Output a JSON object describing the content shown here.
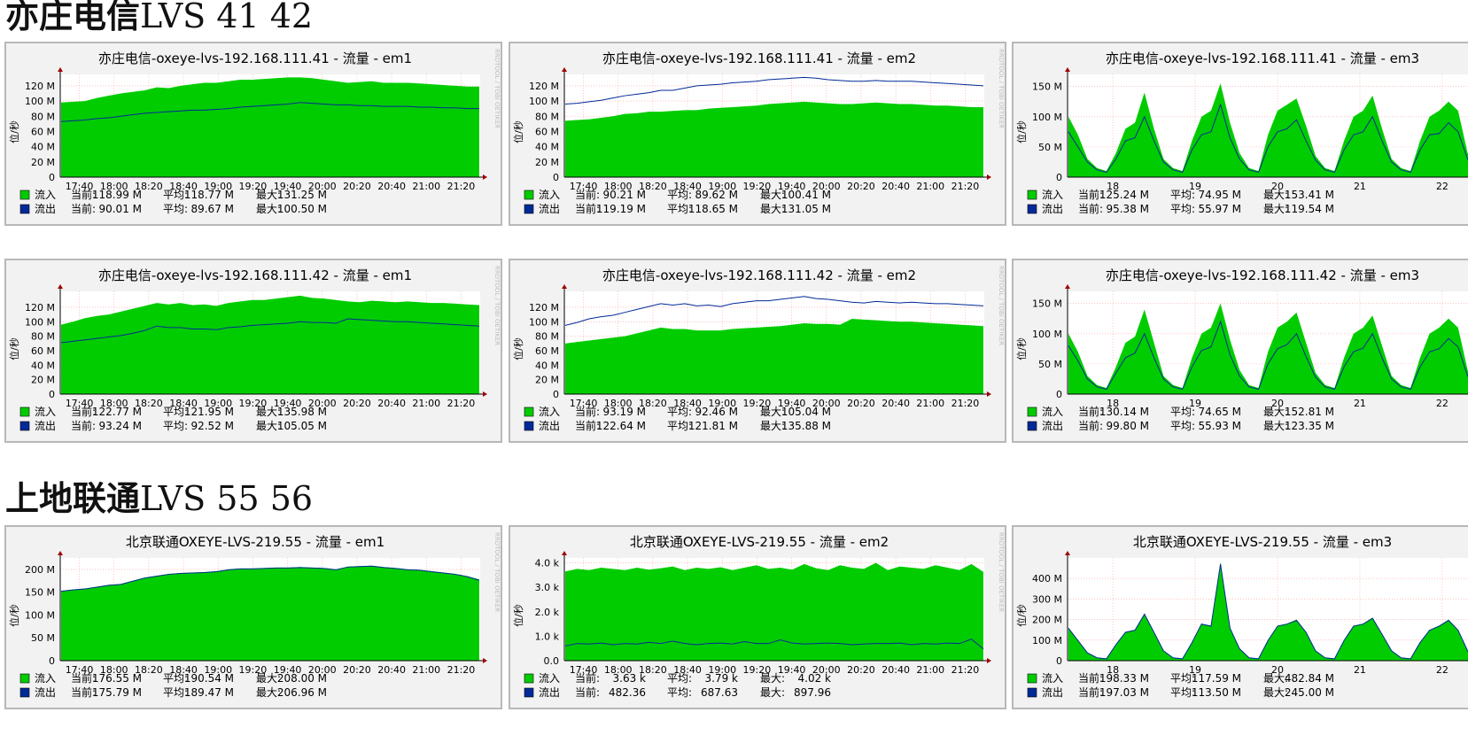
{
  "sections": [
    {
      "title_zh": "亦庄电信",
      "title_rest": "LVS 41 42"
    },
    {
      "title_zh": "上地联通",
      "title_rest": "LVS 55 56"
    }
  ],
  "watermark": "RRDTOOL / TOBI OETIKER",
  "ylabel": "位/秒",
  "legend": {
    "in": "流入",
    "out": "流出",
    "cur": "当前:",
    "avg": "平均:",
    "max": "最大:"
  },
  "colors": {
    "in": "#00cc00",
    "out": "#002a97",
    "grid": "#ff9d9d",
    "bg": "#f2f2f2"
  },
  "chart_data": [
    {
      "type": "area",
      "title": "亦庄电信-oxeye-lvs-192.168.111.41 - 流量 - em1",
      "yticks": [
        "0",
        "20 M",
        "40 M",
        "60 M",
        "80 M",
        "100 M",
        "120 M"
      ],
      "ylim": [
        0,
        135
      ],
      "xticks": [
        "17:40",
        "18:00",
        "18:20",
        "18:40",
        "19:00",
        "19:20",
        "19:40",
        "20:00",
        "20:20",
        "20:40",
        "21:00",
        "21:20"
      ],
      "series": [
        {
          "name": "流入",
          "values": [
            98,
            99,
            100,
            104,
            107,
            110,
            112,
            114,
            118,
            117,
            120,
            122,
            124,
            124,
            126,
            128,
            128,
            129,
            130,
            131,
            131,
            130,
            128,
            126,
            124,
            125,
            126,
            124,
            124,
            124,
            123,
            122,
            121,
            120,
            119,
            119
          ]
        },
        {
          "name": "流出",
          "values": [
            73,
            74,
            75,
            77,
            78,
            80,
            82,
            84,
            85,
            86,
            87,
            88,
            88,
            89,
            90,
            92,
            93,
            94,
            95,
            96,
            98,
            97,
            96,
            95,
            95,
            94,
            94,
            93,
            93,
            93,
            92,
            92,
            91,
            91,
            90,
            90
          ]
        }
      ],
      "stats": {
        "in": [
          "118.99 M",
          "118.77 M",
          "131.25 M"
        ],
        "out": [
          "90.01 M",
          "89.67 M",
          "100.50 M"
        ]
      }
    },
    {
      "type": "area",
      "title": "亦庄电信-oxeye-lvs-192.168.111.41 - 流量 - em2",
      "yticks": [
        "0",
        "20 M",
        "40 M",
        "60 M",
        "80 M",
        "100 M",
        "120 M"
      ],
      "ylim": [
        0,
        135
      ],
      "xticks": [
        "17:40",
        "18:00",
        "18:20",
        "18:40",
        "19:00",
        "19:20",
        "19:40",
        "20:00",
        "20:20",
        "20:40",
        "21:00",
        "21:20"
      ],
      "series": [
        {
          "name": "流入",
          "values": [
            74,
            75,
            76,
            78,
            80,
            83,
            84,
            86,
            86,
            87,
            88,
            88,
            90,
            91,
            92,
            93,
            94,
            96,
            97,
            98,
            99,
            98,
            97,
            96,
            96,
            97,
            98,
            97,
            96,
            96,
            95,
            94,
            94,
            93,
            92,
            92
          ]
        },
        {
          "name": "流出",
          "values": [
            96,
            97,
            99,
            101,
            104,
            107,
            109,
            111,
            114,
            114,
            117,
            120,
            121,
            122,
            124,
            125,
            126,
            128,
            129,
            130,
            131,
            130,
            128,
            127,
            126,
            126,
            127,
            126,
            126,
            126,
            125,
            124,
            123,
            122,
            121,
            120
          ]
        }
      ],
      "stats": {
        "in": [
          "90.21 M",
          "89.62 M",
          "100.41 M"
        ],
        "out": [
          "119.19 M",
          "118.65 M",
          "131.05 M"
        ]
      }
    },
    {
      "type": "area",
      "title": "亦庄电信-oxeye-lvs-192.168.111.41 - 流量 - em3",
      "yticks": [
        "0",
        "50 M",
        "100 M",
        "150 M"
      ],
      "ylim": [
        0,
        170
      ],
      "xticks": [
        "18",
        "19",
        "20",
        "21",
        "22"
      ],
      "series": [
        {
          "name": "流入",
          "values": [
            100,
            70,
            30,
            15,
            10,
            40,
            80,
            90,
            140,
            80,
            30,
            15,
            10,
            60,
            100,
            110,
            155,
            90,
            40,
            15,
            10,
            70,
            110,
            120,
            130,
            85,
            35,
            15,
            10,
            60,
            100,
            110,
            135,
            80,
            30,
            15,
            10,
            60,
            100,
            110,
            125,
            110,
            40,
            15,
            10
          ]
        },
        {
          "name": "流出",
          "values": [
            75,
            50,
            25,
            12,
            8,
            30,
            60,
            65,
            100,
            60,
            25,
            12,
            8,
            45,
            70,
            75,
            120,
            65,
            30,
            12,
            8,
            50,
            75,
            80,
            95,
            60,
            28,
            12,
            8,
            45,
            70,
            75,
            100,
            60,
            25,
            12,
            8,
            45,
            70,
            72,
            90,
            75,
            30,
            12,
            8
          ]
        }
      ],
      "stats": {
        "in": [
          "125.24 M",
          "74.95 M",
          "153.41 M"
        ],
        "out": [
          "95.38 M",
          "55.97 M",
          "119.54 M"
        ]
      }
    },
    {
      "type": "area",
      "title": "亦庄电信-oxeye-lvs-192.168.111.42 - 流量 - em1",
      "yticks": [
        "0",
        "20 M",
        "40 M",
        "60 M",
        "80 M",
        "100 M",
        "120 M"
      ],
      "ylim": [
        0,
        142
      ],
      "xticks": [
        "17:40",
        "18:00",
        "18:20",
        "18:40",
        "19:00",
        "19:20",
        "19:40",
        "20:00",
        "20:20",
        "20:40",
        "21:00",
        "21:20"
      ],
      "series": [
        {
          "name": "流入",
          "values": [
            96,
            100,
            105,
            108,
            110,
            114,
            118,
            122,
            126,
            124,
            126,
            123,
            124,
            122,
            126,
            128,
            130,
            130,
            132,
            134,
            136,
            133,
            132,
            130,
            128,
            127,
            129,
            128,
            127,
            128,
            127,
            126,
            126,
            125,
            124,
            123
          ]
        },
        {
          "name": "流出",
          "values": [
            71,
            73,
            75,
            77,
            79,
            81,
            84,
            88,
            94,
            92,
            92,
            90,
            90,
            89,
            92,
            93,
            95,
            96,
            97,
            98,
            100,
            99,
            99,
            98,
            104,
            103,
            102,
            101,
            100,
            100,
            99,
            98,
            97,
            96,
            95,
            94
          ]
        }
      ],
      "stats": {
        "in": [
          "122.77 M",
          "121.95 M",
          "135.98 M"
        ],
        "out": [
          "93.24 M",
          "92.52 M",
          "105.05 M"
        ]
      }
    },
    {
      "type": "area",
      "title": "亦庄电信-oxeye-lvs-192.168.111.42 - 流量 - em2",
      "yticks": [
        "0",
        "20 M",
        "40 M",
        "60 M",
        "80 M",
        "100 M",
        "120 M"
      ],
      "ylim": [
        0,
        142
      ],
      "xticks": [
        "17:40",
        "18:00",
        "18:20",
        "18:40",
        "19:00",
        "19:20",
        "19:40",
        "20:00",
        "20:20",
        "20:40",
        "21:00",
        "21:20"
      ],
      "series": [
        {
          "name": "流入",
          "values": [
            70,
            72,
            74,
            76,
            78,
            80,
            84,
            88,
            92,
            90,
            90,
            88,
            88,
            88,
            90,
            91,
            92,
            93,
            94,
            96,
            98,
            97,
            97,
            96,
            104,
            103,
            102,
            101,
            100,
            100,
            99,
            98,
            97,
            96,
            95,
            94
          ]
        },
        {
          "name": "流出",
          "values": [
            95,
            99,
            104,
            107,
            109,
            113,
            117,
            121,
            125,
            123,
            125,
            122,
            123,
            121,
            125,
            127,
            129,
            129,
            131,
            133,
            135,
            132,
            131,
            129,
            127,
            126,
            128,
            127,
            126,
            127,
            126,
            125,
            125,
            124,
            123,
            122
          ]
        }
      ],
      "stats": {
        "in": [
          "93.19 M",
          "92.46 M",
          "105.04 M"
        ],
        "out": [
          "122.64 M",
          "121.81 M",
          "135.88 M"
        ]
      }
    },
    {
      "type": "area",
      "title": "亦庄电信-oxeye-lvs-192.168.111.42 - 流量 - em3",
      "yticks": [
        "0",
        "50 M",
        "100 M",
        "150 M"
      ],
      "ylim": [
        0,
        170
      ],
      "xticks": [
        "18",
        "19",
        "20",
        "21",
        "22"
      ],
      "series": [
        {
          "name": "流入",
          "values": [
            100,
            70,
            30,
            15,
            10,
            45,
            85,
            95,
            140,
            85,
            30,
            15,
            10,
            60,
            100,
            110,
            150,
            90,
            40,
            15,
            10,
            70,
            110,
            120,
            135,
            85,
            35,
            15,
            10,
            60,
            100,
            110,
            130,
            80,
            30,
            15,
            10,
            60,
            100,
            110,
            125,
            110,
            40,
            15,
            10
          ]
        },
        {
          "name": "流出",
          "values": [
            80,
            55,
            25,
            12,
            8,
            35,
            60,
            68,
            100,
            60,
            25,
            12,
            8,
            45,
            72,
            78,
            120,
            65,
            30,
            12,
            8,
            50,
            75,
            82,
            100,
            62,
            28,
            12,
            8,
            45,
            70,
            76,
            100,
            60,
            25,
            12,
            8,
            45,
            70,
            75,
            92,
            78,
            30,
            12,
            8
          ]
        }
      ],
      "stats": {
        "in": [
          "130.14 M",
          "74.65 M",
          "152.81 M"
        ],
        "out": [
          "99.80 M",
          "55.93 M",
          "123.35 M"
        ]
      }
    },
    {
      "type": "area",
      "title": "北京联通OXEYE-LVS-219.55 - 流量 - em1",
      "yticks": [
        "0",
        "50 M",
        "100 M",
        "150 M",
        "200 M"
      ],
      "ylim": [
        0,
        225
      ],
      "xticks": [
        "17:40",
        "18:00",
        "18:20",
        "18:40",
        "19:00",
        "19:20",
        "19:40",
        "20:00",
        "20:20",
        "20:40",
        "21:00",
        "21:20"
      ],
      "series": [
        {
          "name": "流入",
          "values": [
            153,
            156,
            158,
            162,
            166,
            168,
            175,
            182,
            186,
            190,
            192,
            193,
            194,
            196,
            200,
            202,
            202,
            203,
            204,
            204,
            205,
            204,
            203,
            200,
            206,
            207,
            208,
            205,
            203,
            200,
            199,
            196,
            193,
            190,
            185,
            178
          ]
        },
        {
          "name": "流出",
          "values": [
            152,
            155,
            157,
            161,
            165,
            167,
            174,
            181,
            185,
            189,
            191,
            192,
            193,
            195,
            199,
            201,
            201,
            202,
            203,
            203,
            204,
            203,
            202,
            199,
            205,
            206,
            207,
            204,
            202,
            199,
            198,
            195,
            192,
            189,
            184,
            176
          ]
        }
      ],
      "stats": {
        "in": [
          "176.55 M",
          "190.54 M",
          "208.00 M"
        ],
        "out": [
          "175.79 M",
          "189.47 M",
          "206.96 M"
        ]
      }
    },
    {
      "type": "area",
      "title": "北京联通OXEYE-LVS-219.55 - 流量 - em2",
      "yticks": [
        "0.0",
        "1.0 k",
        "2.0 k",
        "3.0 k",
        "4.0 k"
      ],
      "ylim": [
        0,
        4.2
      ],
      "xticks": [
        "17:40",
        "18:00",
        "18:20",
        "18:40",
        "19:00",
        "19:20",
        "19:40",
        "20:00",
        "20:20",
        "20:40",
        "21:00",
        "21:20"
      ],
      "series": [
        {
          "name": "流入",
          "values": [
            3.65,
            3.75,
            3.7,
            3.8,
            3.75,
            3.7,
            3.8,
            3.72,
            3.78,
            3.85,
            3.7,
            3.8,
            3.75,
            3.82,
            3.7,
            3.8,
            3.9,
            3.75,
            3.8,
            3.72,
            3.95,
            3.78,
            3.7,
            3.9,
            3.8,
            3.75,
            4.0,
            3.7,
            3.85,
            3.8,
            3.75,
            3.9,
            3.8,
            3.7,
            3.95,
            3.63
          ]
        },
        {
          "name": "流出",
          "values": [
            0.6,
            0.7,
            0.68,
            0.72,
            0.65,
            0.7,
            0.68,
            0.75,
            0.7,
            0.8,
            0.7,
            0.65,
            0.7,
            0.72,
            0.68,
            0.78,
            0.7,
            0.7,
            0.85,
            0.72,
            0.68,
            0.7,
            0.72,
            0.7,
            0.65,
            0.68,
            0.7,
            0.7,
            0.72,
            0.65,
            0.7,
            0.68,
            0.72,
            0.7,
            0.88,
            0.48
          ]
        }
      ],
      "stats": {
        "in": [
          "3.63 k",
          "3.79 k",
          "4.02 k"
        ],
        "out": [
          "482.36",
          "687.63",
          "897.96"
        ]
      }
    },
    {
      "type": "area",
      "title": "北京联通OXEYE-LVS-219.55 - 流量 - em3",
      "yticks": [
        "0",
        "100 M",
        "200 M",
        "300 M",
        "400 M"
      ],
      "ylim": [
        0,
        500
      ],
      "xticks": [
        "18",
        "19",
        "20",
        "21",
        "22"
      ],
      "series": [
        {
          "name": "流入",
          "values": [
            160,
            100,
            40,
            15,
            10,
            80,
            140,
            150,
            230,
            140,
            50,
            15,
            10,
            90,
            180,
            170,
            480,
            160,
            60,
            15,
            10,
            100,
            170,
            180,
            200,
            140,
            50,
            15,
            10,
            100,
            170,
            180,
            210,
            130,
            50,
            15,
            10,
            90,
            150,
            170,
            200,
            150,
            50,
            15,
            10
          ]
        },
        {
          "name": "流出",
          "values": [
            158,
            98,
            38,
            14,
            9,
            78,
            138,
            148,
            226,
            138,
            48,
            14,
            9,
            88,
            178,
            168,
            470,
            158,
            58,
            14,
            9,
            98,
            168,
            178,
            196,
            138,
            48,
            14,
            9,
            98,
            168,
            178,
            206,
            128,
            48,
            14,
            9,
            88,
            148,
            168,
            196,
            148,
            48,
            14,
            9
          ]
        }
      ],
      "stats": {
        "in": [
          "198.33 M",
          "117.59 M",
          "482.84 M"
        ],
        "out": [
          "197.03 M",
          "113.50 M",
          "245.00 M"
        ]
      }
    }
  ]
}
